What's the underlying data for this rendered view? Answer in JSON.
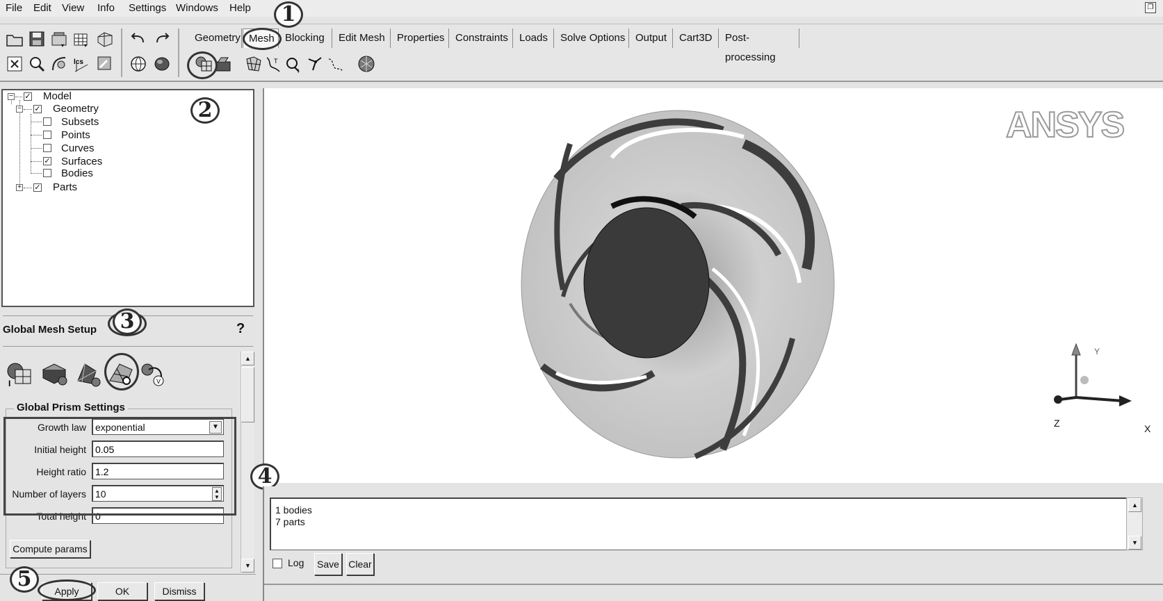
{
  "menu": [
    "File",
    "Edit",
    "View",
    "Info",
    "Settings",
    "Windows",
    "Help"
  ],
  "tabs": [
    "Geometry",
    "Mesh",
    "Blocking",
    "Edit Mesh",
    "Properties",
    "Constraints",
    "Loads",
    "Solve Options",
    "Output",
    "Cart3D",
    "Post-processing"
  ],
  "active_tab": "Mesh",
  "annotations": [
    "1",
    "2",
    "3",
    "4",
    "5"
  ],
  "tree": {
    "model": "Model",
    "geometry": "Geometry",
    "subsets": "Subsets",
    "points": "Points",
    "curves": "Curves",
    "surfaces": "Surfaces",
    "bodies": "Bodies",
    "parts": "Parts",
    "checked": [
      "Model",
      "Geometry",
      "Surfaces",
      "Parts"
    ]
  },
  "global_mesh_setup": {
    "title": "Global Mesh Setup",
    "section": "Global Prism Settings",
    "growth_law_label": "Growth law",
    "growth_law_value": "exponential",
    "initial_height_label": "Initial height",
    "initial_height_value": "0.05",
    "height_ratio_label": "Height ratio",
    "height_ratio_value": "1.2",
    "num_layers_label": "Number of layers",
    "num_layers_value": "10",
    "total_height_label": "Total height",
    "total_height_value": "0",
    "compute_params_label": "Compute params",
    "apply_label": "Apply",
    "ok_label": "OK",
    "dismiss_label": "Dismiss"
  },
  "viewport": {
    "logo": "ANSYS",
    "axis_x": "X",
    "axis_y": "Y",
    "axis_z": "Z"
  },
  "messages": {
    "line1": "1 bodies",
    "line2": "7 parts",
    "log_label": "Log",
    "save_label": "Save",
    "clear_label": "Clear"
  },
  "colors": {
    "impeller_light": "#c4c4c4",
    "impeller_dark": "#3f3f3f",
    "hub": "#3a3a3a"
  }
}
